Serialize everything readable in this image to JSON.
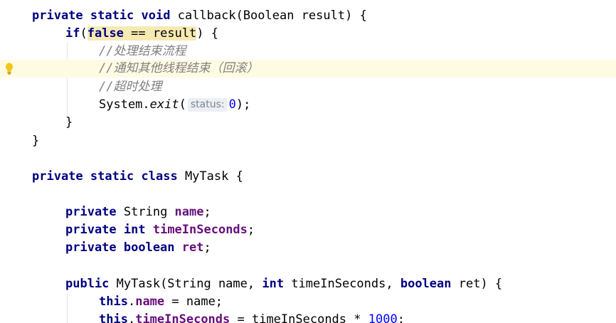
{
  "editor": {
    "lines": {
      "l1": {
        "kw": "private static void",
        "rest": " callback(Boolean result) {"
      },
      "l2": {
        "kw_if": "if",
        "paren": "(",
        "kw_false": "false",
        "mid": " == ",
        "result": "result",
        "end": ") {"
      },
      "l3": {
        "comment": "//处理结束流程"
      },
      "l4": {
        "comment": "//通知其他线程结束（回滚）"
      },
      "l5": {
        "comment": "//超时处理"
      },
      "l6": {
        "pre": "System.",
        "method": "exit",
        "open": "(",
        "hint": "status:",
        "num": "0",
        "close": ");"
      },
      "l7": {
        "text": "}"
      },
      "l8": {
        "text": "}"
      },
      "l9": {
        "kw": "private static class",
        "rest": " MyTask {"
      },
      "l10": {
        "kw": "private",
        "type": " String ",
        "field": "name",
        "end": ";"
      },
      "l11": {
        "kw": "private int",
        "sp": " ",
        "field": "timeInSeconds",
        "end": ";"
      },
      "l12": {
        "kw": "private boolean",
        "sp": " ",
        "field": "ret",
        "end": ";"
      },
      "l13": {
        "kw_public": "public",
        "a": " MyTask(String name, ",
        "kw_int": "int",
        "b": " timeInSeconds, ",
        "kw_boolean": "boolean",
        "c": " ret) {"
      },
      "l14": {
        "kw_this": "this",
        "dot": ".",
        "field": "name",
        "rest": " = name;"
      },
      "l15": {
        "kw_this": "this",
        "dot": ".",
        "field": "timeInSeconds",
        "rest": " = timeInSeconds * ",
        "num": "1000",
        "end": ";"
      }
    },
    "intention_icon": "lightbulb-icon",
    "colors": {
      "keyword": "#000080",
      "field": "#660e7a",
      "number": "#0000ff",
      "comment": "#808080",
      "current_line": "#fffbe3",
      "match_highlight": "#f6eab3"
    }
  }
}
